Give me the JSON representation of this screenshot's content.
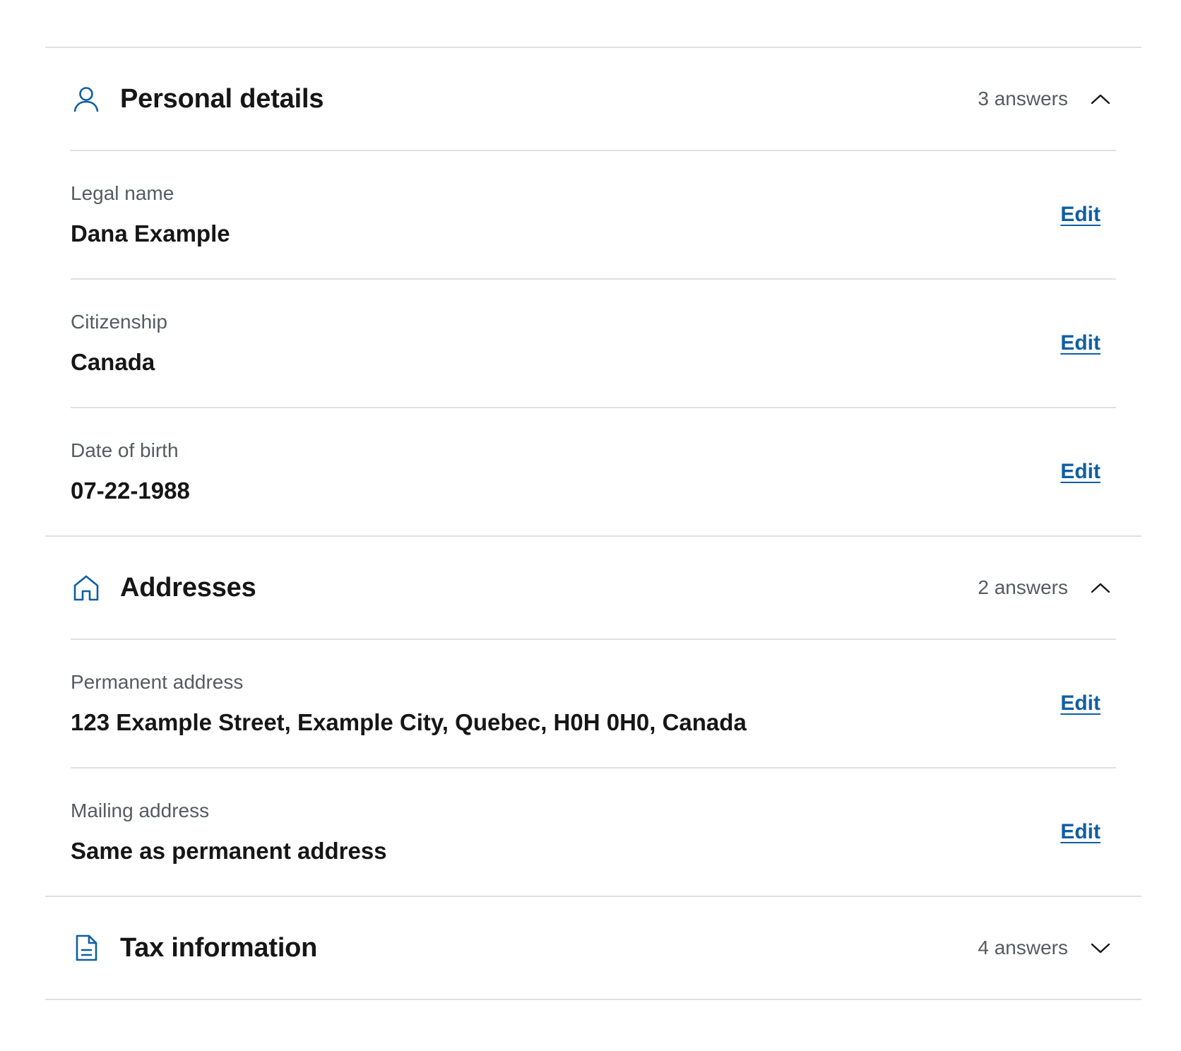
{
  "colors": {
    "accent": "#0f5ea3",
    "text": "#161616",
    "muted": "#555b61",
    "divider": "#e0e0e0"
  },
  "sections": [
    {
      "title": "Personal details",
      "icon": "person-icon",
      "answers": "3 answers",
      "expanded": true,
      "rows": [
        {
          "label": "Legal name",
          "value": "Dana Example",
          "action": "Edit"
        },
        {
          "label": "Citizenship",
          "value": "Canada",
          "action": "Edit"
        },
        {
          "label": "Date of birth",
          "value": "07-22-1988",
          "action": "Edit"
        }
      ]
    },
    {
      "title": "Addresses",
      "icon": "home-icon",
      "answers": "2 answers",
      "expanded": true,
      "rows": [
        {
          "label": "Permanent address",
          "value": "123 Example Street, Example City, Quebec, H0H 0H0, Canada",
          "action": "Edit"
        },
        {
          "label": "Mailing address",
          "value": "Same as permanent address",
          "action": "Edit"
        }
      ]
    },
    {
      "title": "Tax information",
      "icon": "document-icon",
      "answers": "4 answers",
      "expanded": false,
      "rows": []
    }
  ]
}
